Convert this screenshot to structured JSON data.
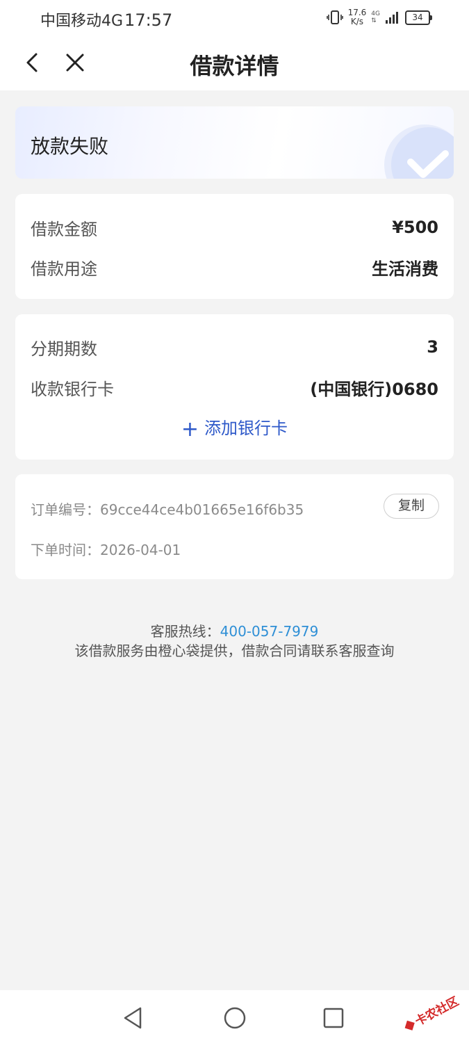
{
  "status_bar": {
    "carrier": "中国移动4G",
    "time": "17:57",
    "net_speed_value": "17.6",
    "net_speed_unit": "K/s",
    "network_type": "4G",
    "battery": "34"
  },
  "nav": {
    "title": "借款详情"
  },
  "loan_status": {
    "text": "放款失败"
  },
  "loan_info": {
    "amount_label": "借款金额",
    "amount_value": "¥500",
    "purpose_label": "借款用途",
    "purpose_value": "生活消费"
  },
  "installment_info": {
    "periods_label": "分期期数",
    "periods_value": "3",
    "bank_label": "收款银行卡",
    "bank_value": "(中国银行)0680",
    "add_card_label": "添加银行卡"
  },
  "order_info": {
    "order_no_label": "订单编号：",
    "order_no_value": "69cce44ce4b01665e16f6b35",
    "copy_label": "复制",
    "order_time_label": "下单时间：",
    "order_time_value": "2026-04-01"
  },
  "footer": {
    "hotline_label": "客服热线：",
    "hotline_number": "400-057-7979",
    "provider_text": "该借款服务由橙心袋提供，借款合同请联系客服查询"
  },
  "watermark": {
    "text": "卡农社区"
  },
  "colors": {
    "accent_blue": "#2e59c9",
    "link_blue": "#2e8fd6",
    "page_bg": "#f3f3f3"
  }
}
